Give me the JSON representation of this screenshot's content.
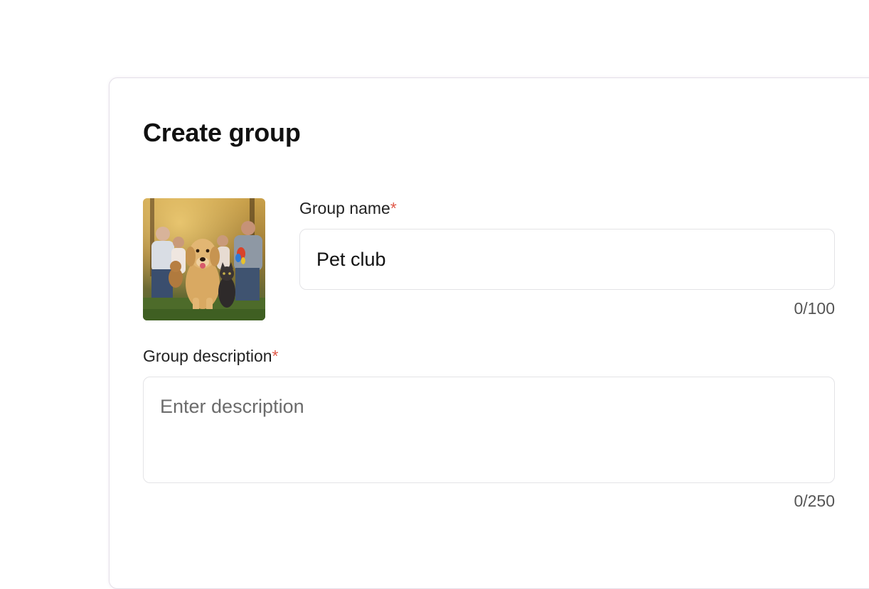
{
  "form": {
    "title": "Create group",
    "name_label": "Group name",
    "description_label": "Group description",
    "required_mark": "*",
    "name_value": "Pet club",
    "name_counter": "0/100",
    "description_placeholder": "Enter description",
    "description_counter": "0/250"
  },
  "colors": {
    "required": "#e05a4a",
    "border": "#e3e3e6",
    "card_border": "#e4dfe8"
  }
}
